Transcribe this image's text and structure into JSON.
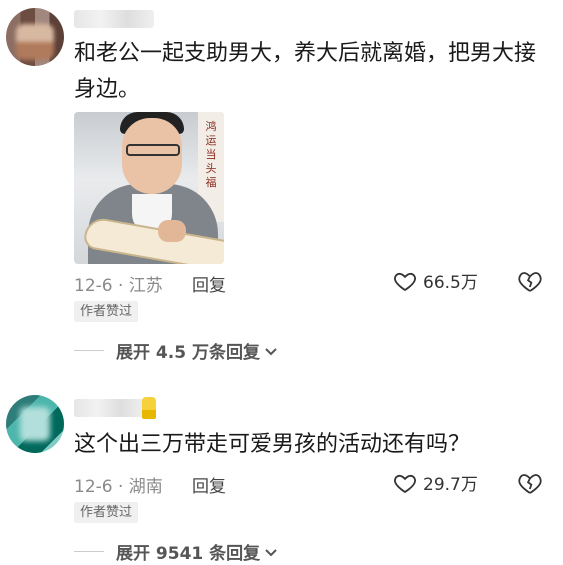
{
  "comments": [
    {
      "text": "和老公一起支助男大，养大后就离婚，把男大接身边。",
      "date_location": "12-6 · 江苏",
      "reply_label": "回复",
      "likes": "66.5万",
      "author_tag": "作者赞过",
      "expand_label": "展开 4.5 万条回复",
      "photo_caption_chars": "鸿\n运\n当\n头\n福"
    },
    {
      "text": "这个出三万带走可爱男孩的活动还有吗？",
      "date_location": "12-6 · 湖南",
      "reply_label": "回复",
      "likes": "29.7万",
      "author_tag": "作者赞过",
      "expand_label": "展开 9541 条回复"
    }
  ],
  "icons": {
    "like": "heart-outline-icon",
    "dislike": "broken-heart-icon",
    "expand": "chevron-down-icon"
  },
  "colors": {
    "text": "#1a1a1a",
    "meta": "#8a8a8a",
    "tag_bg": "#f0f0f0"
  }
}
